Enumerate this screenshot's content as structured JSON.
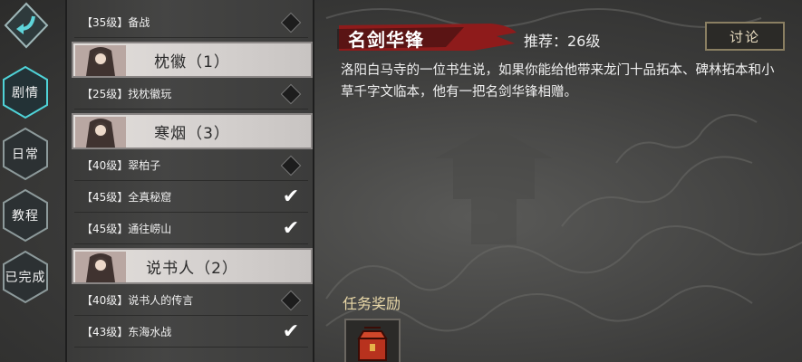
{
  "nav": {
    "items": [
      {
        "label": "剧情",
        "active": true
      },
      {
        "label": "日常",
        "active": false
      },
      {
        "label": "教程",
        "active": false
      },
      {
        "label": "已完成",
        "active": false
      }
    ]
  },
  "quest_list": [
    {
      "kind": "quest",
      "text": "【35级】备战",
      "state": "locked"
    },
    {
      "kind": "group",
      "text": "枕徽（1）"
    },
    {
      "kind": "quest",
      "text": "【25级】找枕徽玩",
      "state": "locked"
    },
    {
      "kind": "group",
      "text": "寒烟（3）"
    },
    {
      "kind": "quest",
      "text": "【40级】翠柏子",
      "state": "locked"
    },
    {
      "kind": "quest",
      "text": "【45级】全真秘窟",
      "state": "done"
    },
    {
      "kind": "quest",
      "text": "【45级】通往崂山",
      "state": "done"
    },
    {
      "kind": "group",
      "text": "说书人（2）"
    },
    {
      "kind": "quest",
      "text": "【40级】说书人的传言",
      "state": "locked"
    },
    {
      "kind": "quest",
      "text": "【43级】东海水战",
      "state": "done"
    }
  ],
  "detail": {
    "title": "名剑华锋",
    "recommend": "推荐：26级",
    "discuss_label": "讨论",
    "description": "洛阳白马寺的一位书生说，如果你能给他带来龙门十品拓本、碑林拓本和小草千字文临本，他有一把名剑华锋相赠。",
    "reward_label": "任务奖励",
    "reward_icon": "red-chest-icon"
  },
  "colors": {
    "accent_teal": "#4fd3d8",
    "banner_red": "#8e1b1b"
  }
}
